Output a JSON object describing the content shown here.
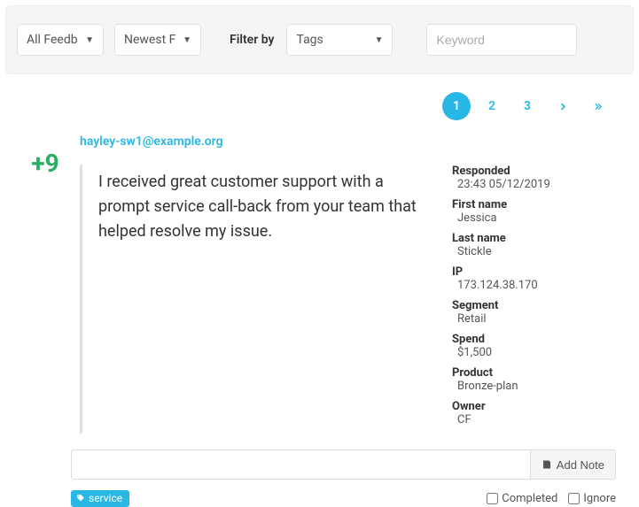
{
  "toolbar": {
    "feedback_filter": "All Feedb",
    "sort": "Newest F",
    "filter_by_label": "Filter by",
    "tags_filter": "Tags",
    "keyword_placeholder": "Keyword"
  },
  "pagination": {
    "pages": [
      "1",
      "2",
      "3"
    ],
    "active": "1"
  },
  "feedback": {
    "score": "+9",
    "email": "hayley-sw1@example.org",
    "text": "I received great customer support with a prompt service call-back from your team that helped resolve my issue.",
    "meta": {
      "responded_label": "Responded",
      "responded_value": "23:43 05/12/2019",
      "firstname_label": "First name",
      "firstname_value": "Jessica",
      "lastname_label": "Last name",
      "lastname_value": "Stickle",
      "ip_label": "IP",
      "ip_value": "173.124.38.170",
      "segment_label": "Segment",
      "segment_value": "Retail",
      "spend_label": "Spend",
      "spend_value": "$1,500",
      "product_label": "Product",
      "product_value": "Bronze-plan",
      "owner_label": "Owner",
      "owner_value": "CF"
    },
    "add_note_label": "Add Note",
    "tag": "service",
    "completed_label": "Completed",
    "ignore_label": "Ignore"
  }
}
